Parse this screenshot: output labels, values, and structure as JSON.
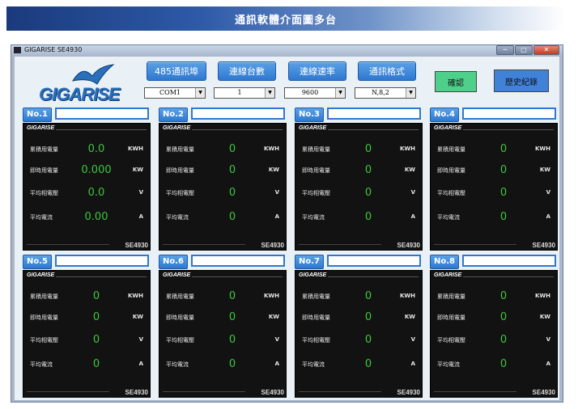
{
  "banner": {
    "title": "通訊軟體介面圖多台"
  },
  "window": {
    "title": "GIGARISE    SE4930",
    "minimize": "─",
    "maximize": "□",
    "close": "✕"
  },
  "logo": {
    "text": "GIGARISE"
  },
  "toolbar": {
    "buttons": [
      {
        "label": "485通訊埠",
        "select_value": "COM1"
      },
      {
        "label": "連線台數",
        "select_value": "1"
      },
      {
        "label": "連線速率",
        "select_value": "9600"
      },
      {
        "label": "通訊格式",
        "select_value": "N,8,2"
      }
    ],
    "confirm_label": "確認",
    "history_label": "歷史紀錄",
    "dropdown_arrow": "▼"
  },
  "panel_common": {
    "brand": "GIGARISE",
    "model": "SE4930",
    "labels": [
      "累積用電量",
      "即時用電量",
      "平均相電壓",
      "平均電流"
    ],
    "units": [
      "KWH",
      "KW",
      "V",
      "A"
    ]
  },
  "panels": [
    {
      "no": "No.1",
      "values": [
        "0.0",
        "0.000",
        "0.0",
        "0.00"
      ]
    },
    {
      "no": "No.2",
      "values": [
        "0",
        "0",
        "0",
        "0"
      ]
    },
    {
      "no": "No.3",
      "values": [
        "0",
        "0",
        "0",
        "0"
      ]
    },
    {
      "no": "No.4",
      "values": [
        "0",
        "0",
        "0",
        "0"
      ]
    },
    {
      "no": "No.5",
      "values": [
        "0",
        "0",
        "0",
        "0"
      ]
    },
    {
      "no": "No.6",
      "values": [
        "0",
        "0",
        "0",
        "0"
      ]
    },
    {
      "no": "No.7",
      "values": [
        "0",
        "0",
        "0",
        "0"
      ]
    },
    {
      "no": "No.8",
      "values": [
        "0",
        "0",
        "0",
        "0"
      ]
    }
  ],
  "colors": {
    "value_green": "#3cc73c",
    "accent_blue": "#2f78cf",
    "confirm_bg": "#4fd08a",
    "history_bg": "#3f82d8"
  }
}
